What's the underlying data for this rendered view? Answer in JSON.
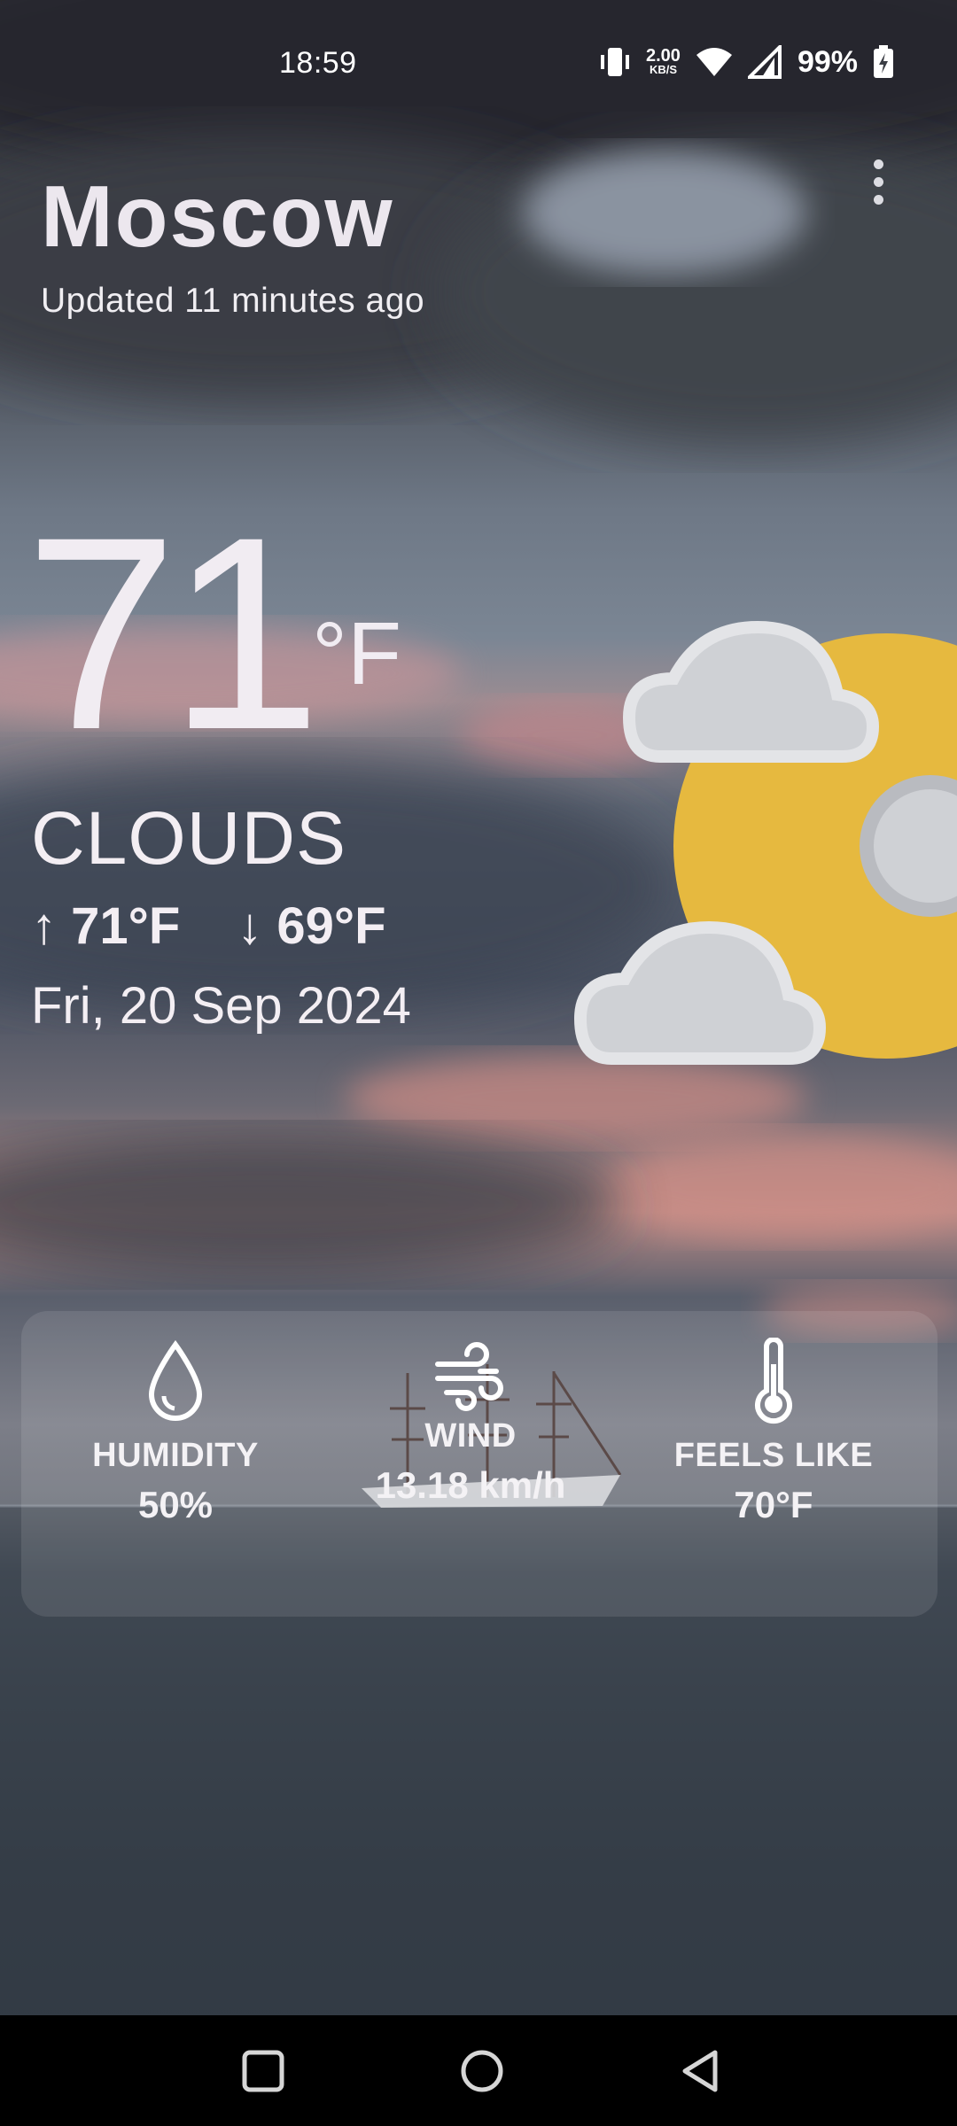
{
  "status_bar": {
    "time": "18:59",
    "net_speed_value": "2.00",
    "net_speed_unit": "KB/S",
    "battery_percent": "99%",
    "icons": [
      "vibrate-icon",
      "wifi-icon",
      "signal-icon",
      "battery-charging-icon"
    ]
  },
  "header": {
    "city": "Moscow",
    "updated": "Updated 11 minutes ago",
    "menu_icon": "more-vertical-icon"
  },
  "current": {
    "temperature": "71",
    "unit": "°F",
    "condition": "CLOUDS",
    "high": "↑ 71°F",
    "low": "↓ 69°F",
    "date": "Fri, 20 Sep 2024",
    "art_icon": "sun-behind-clouds-icon",
    "colors": {
      "sun": "#e6b93f",
      "cloud": "#cfd1d5"
    }
  },
  "details": [
    {
      "icon": "water-drop-icon",
      "label": "HUMIDITY",
      "value": "50%"
    },
    {
      "icon": "wind-icon",
      "label": "WIND",
      "value": "13.18 km/h"
    },
    {
      "icon": "thermometer-icon",
      "label": "FEELS LIKE",
      "value": "70°F"
    }
  ],
  "nav_bar": {
    "buttons": [
      "recents-square-icon",
      "home-circle-icon",
      "back-triangle-icon"
    ]
  }
}
